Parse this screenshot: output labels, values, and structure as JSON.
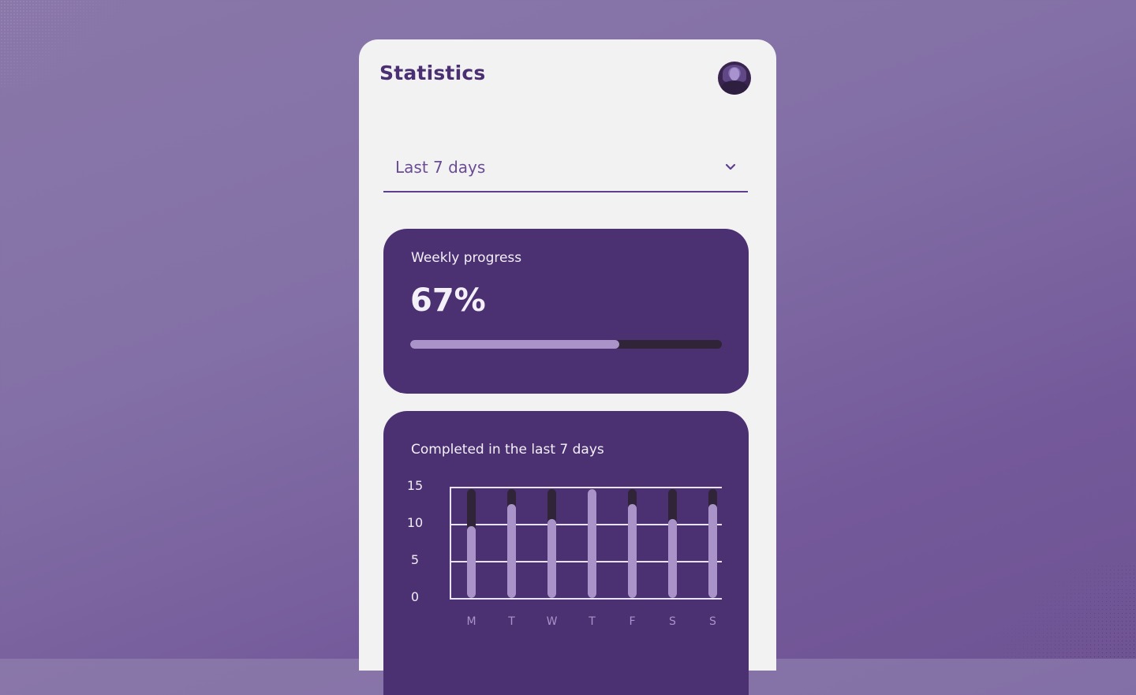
{
  "header": {
    "title": "Statistics",
    "avatar_icon": "user-avatar-icon"
  },
  "filter": {
    "selected": "Last 7 days",
    "chevron_icon": "chevron-down-icon"
  },
  "weekly_progress": {
    "title": "Weekly progress",
    "value_label": "67%",
    "percent": 67
  },
  "colors": {
    "primary": "#4b3072",
    "accent_light": "#a993c8",
    "track": "#302438",
    "panel": "#f2f2f3",
    "title_text": "#4a2f72"
  },
  "chart_data": {
    "type": "bar",
    "title": "Completed in the last 7 days",
    "categories": [
      "M",
      "T",
      "W",
      "T",
      "F",
      "S",
      "S"
    ],
    "values": [
      10,
      13,
      11,
      15,
      13,
      11,
      13
    ],
    "max_values": [
      15,
      15,
      15,
      15,
      15,
      15,
      15
    ],
    "yticks": [
      "15",
      "10",
      "5",
      "0"
    ],
    "ylim": [
      0,
      15
    ],
    "grid": true,
    "xlabel": "",
    "ylabel": ""
  }
}
